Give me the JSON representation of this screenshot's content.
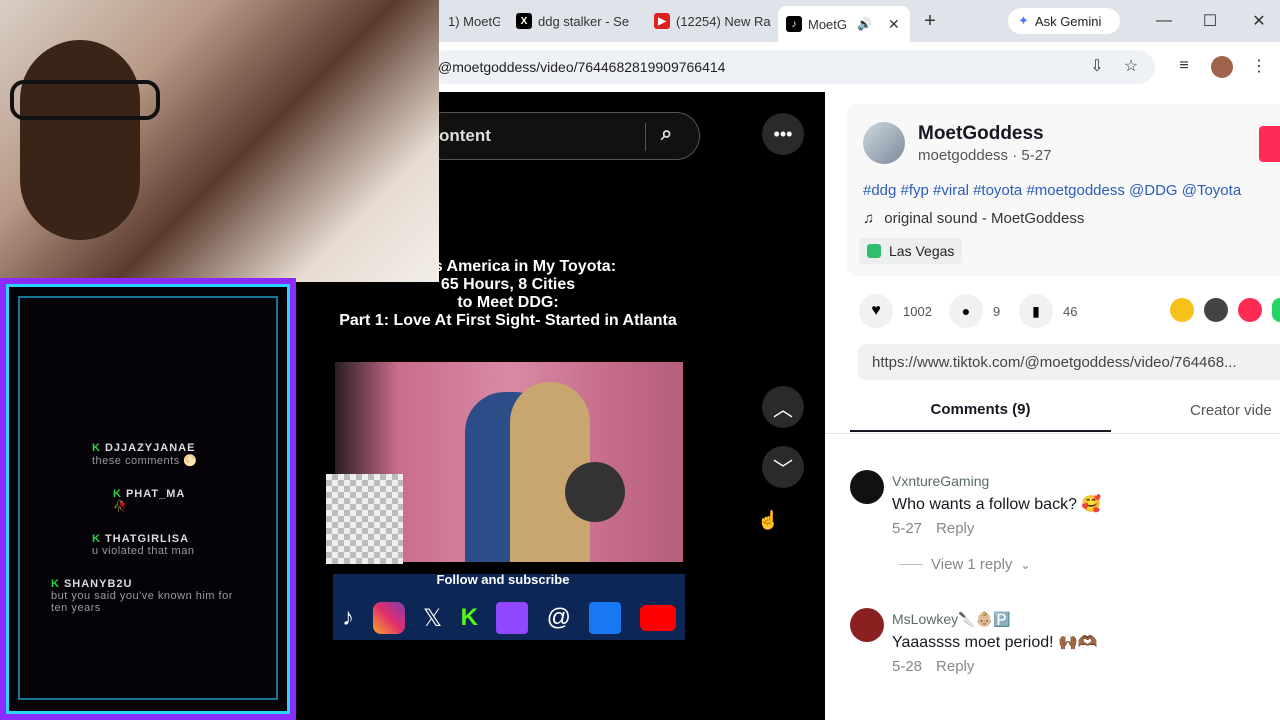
{
  "browser": {
    "tabs": [
      {
        "label": "1) MoetG",
        "icon": "tiktok-icon"
      },
      {
        "label": "ddg stalker - Se",
        "icon": "x-icon"
      },
      {
        "label": "(12254) New Ra",
        "icon": "youtube-icon"
      },
      {
        "label": "MoetG",
        "icon": "tiktok-icon",
        "active": true
      }
    ],
    "gemini_label": "Ask Gemini",
    "url": "@moetgoddess/video/7644682819909766414"
  },
  "video": {
    "search_placeholder": "ontent",
    "title_lines": [
      "cross America in My Toyota:",
      "65 Hours, 8 Cities",
      "to Meet DDG:",
      "Part 1: Love At First Sight- Started in Atlanta"
    ],
    "follow_text": "Follow and subscribe"
  },
  "post": {
    "display_name": "MoetGoddess",
    "handle_date": "moetgoddess · 5-27",
    "tags": "#ddg #fyp #viral #toyota #moetgoddess @DDG @Toyota",
    "sound": "original sound - MoetGoddess",
    "location": "Las Vegas",
    "likes": "1002",
    "comments_count": "9",
    "saves": "46",
    "link": "https://www.tiktok.com/@moetgoddess/video/764468...",
    "tab_comments": "Comments (9)",
    "tab_creator": "Creator vide"
  },
  "comments": [
    {
      "user": "VxntureGaming",
      "text": "Who wants a follow back? 🥰",
      "date": "5-27",
      "reply": "Reply",
      "view_replies": "View 1 reply"
    },
    {
      "user": "MsLowkey🔪👶🏼🅿️",
      "text": "Yaaassss moet period! 🙌🏾🫶🏾",
      "date": "5-28",
      "reply": "Reply"
    }
  ],
  "chat": [
    {
      "user": "DJJAZYJANAE",
      "msg": "these comments 🌕"
    },
    {
      "user": "PHAT_MA",
      "msg": "🥀"
    },
    {
      "user": "THATGIRLISA",
      "msg": "u violated that man"
    },
    {
      "user": "SHANYB2U",
      "msg": "but you said you've known him for ten years"
    }
  ]
}
